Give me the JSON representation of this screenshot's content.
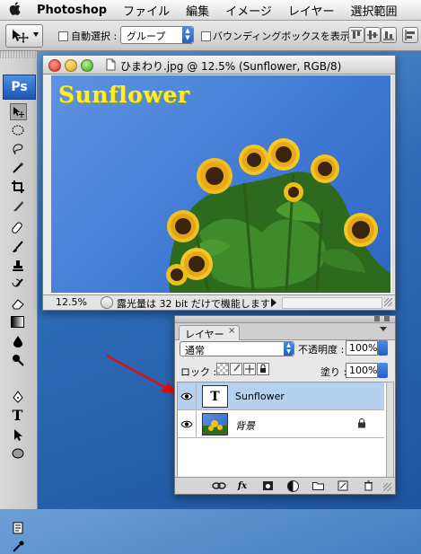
{
  "menubar": {
    "app_name": "Photoshop",
    "items": [
      "ファイル",
      "編集",
      "イメージ",
      "レイヤー",
      "選択範囲"
    ]
  },
  "options_bar": {
    "auto_select_label": "自動選択 :",
    "auto_select_value": "グループ",
    "bounding_box_label": "バウンディングボックスを表示"
  },
  "tools": {
    "ps_logo": "Ps"
  },
  "document": {
    "title": "ひまわり.jpg @ 12.5% (Sunflower, RGB/8)",
    "canvas_text": "Sunflower",
    "zoom": "12.5%",
    "status_text": "露光量は 32 bit だけで機能します"
  },
  "layers_panel": {
    "tab_label": "レイヤー",
    "blend_mode": "通常",
    "opacity_label": "不透明度 :",
    "opacity_value": "100%",
    "lock_label": "ロック :",
    "fill_label": "塗り :",
    "fill_value": "100%",
    "layers": [
      {
        "name": "Sunflower",
        "type": "text",
        "thumb_glyph": "T",
        "selected": true,
        "visible": true
      },
      {
        "name": "背景",
        "type": "image",
        "selected": false,
        "visible": true,
        "locked": true
      }
    ],
    "bottom_icons": [
      "link-icon",
      "fx-icon",
      "mask-icon",
      "adjustment-icon",
      "folder-icon",
      "new-layer-icon",
      "trash-icon"
    ],
    "fx_label": "fx"
  },
  "colors": {
    "accent": "#1f63d4",
    "canvas_text": "#ffef2a",
    "selected_layer": "#b6d1ef",
    "arrow": "#e01010"
  }
}
